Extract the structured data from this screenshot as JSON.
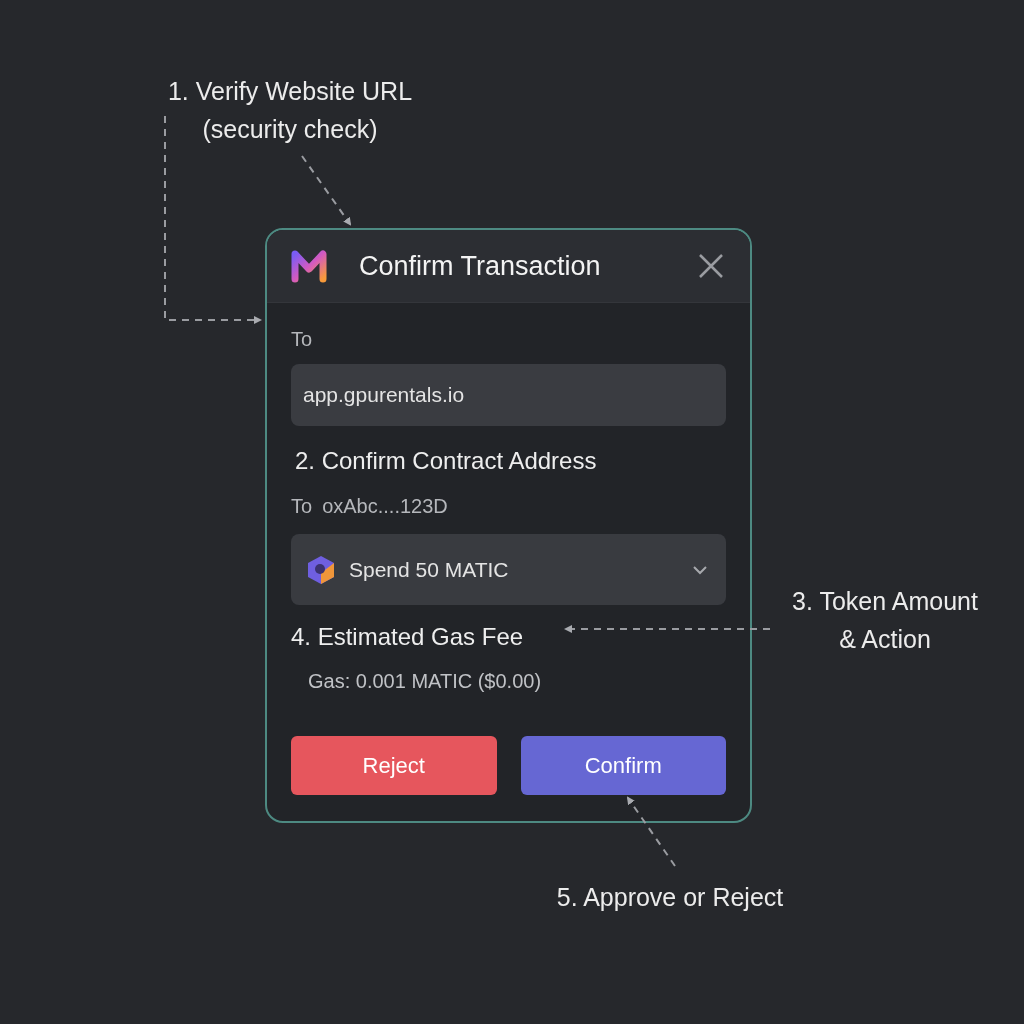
{
  "annotations": [
    {
      "lines": [
        "1. Verify Website URL",
        "(security check)"
      ]
    },
    {
      "lines": [
        "3. Token Amount",
        "& Action"
      ]
    },
    {
      "lines": [
        "5. Approve or Reject"
      ]
    }
  ],
  "dialog": {
    "title": "Confirm Transaction",
    "to_label": "To",
    "to_field": {
      "value": "app.gpurentals.io"
    },
    "contract_heading": "2. Confirm Contract Address",
    "contract": {
      "label": "To",
      "address": "oxAbc....123D"
    },
    "token_select": {
      "value": "Spend 50 MATIC"
    },
    "gas_heading": "4. Estimated Gas Fee",
    "gas_text": "Gas: 0.001 MATIC ($0.00)",
    "buttons": [
      {
        "label": "Reject",
        "kind": "reject"
      },
      {
        "label": "Confirm",
        "kind": "confirm"
      }
    ]
  }
}
